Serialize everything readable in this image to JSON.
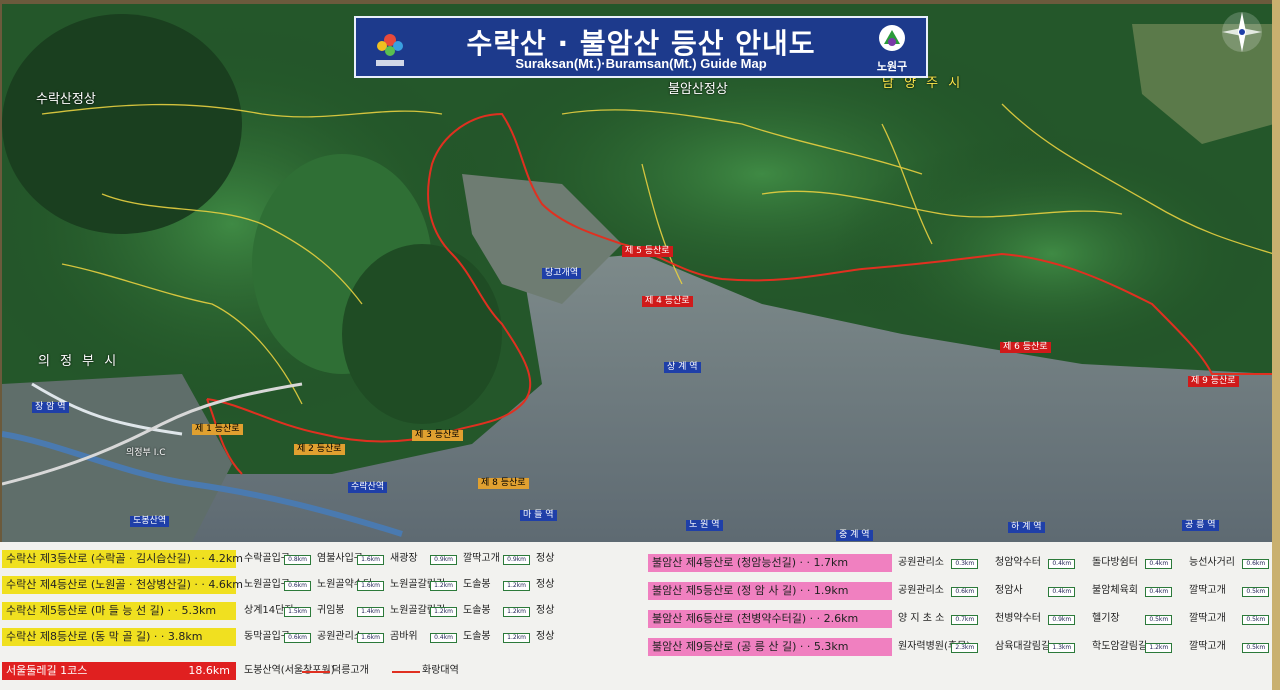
{
  "title": {
    "main": "수락산 · 불암산 등산 안내도",
    "sub": "Suraksan(Mt.)·Buramsan(Mt.) Guide Map",
    "org": "노원구"
  },
  "map_labels": {
    "cities": [
      {
        "name": "의 정 부 시",
        "color": "white"
      },
      {
        "name": "남 양 주 시",
        "color": "yellow"
      }
    ],
    "peaks": [
      {
        "name": "수락산정상"
      },
      {
        "name": "불암산정상"
      }
    ],
    "stations": [
      {
        "name": "장 암 역"
      },
      {
        "name": "도봉산역"
      },
      {
        "name": "수락산역"
      },
      {
        "name": "마 들 역"
      },
      {
        "name": "당고개역"
      },
      {
        "name": "상 계 역"
      },
      {
        "name": "노 원 역"
      },
      {
        "name": "중 계 역"
      },
      {
        "name": "하 계 역"
      },
      {
        "name": "공 릉 역"
      }
    ],
    "places": [
      {
        "name": "의정부 I.C"
      },
      {
        "name": "제 1 등산로"
      },
      {
        "name": "제 2 등산로"
      },
      {
        "name": "제 3 등산로"
      },
      {
        "name": "제 4 등산로"
      },
      {
        "name": "제 5 등산로"
      },
      {
        "name": "제 6 등산로"
      },
      {
        "name": "제 8 등산로"
      },
      {
        "name": "제 9 등산로"
      }
    ]
  },
  "legend": {
    "left_routes": [
      {
        "label": "수락산 제3등산로 (수락골 · 김시습산길) · · 4.2km",
        "color": "yellow",
        "stops": [
          "수락골입구",
          "염불사입구",
          "새광장",
          "깔딱고개",
          "정상"
        ],
        "dists": [
          "0.8km",
          "1.6km",
          "0.9km",
          "0.9km"
        ]
      },
      {
        "label": "수락산 제4등산로 (노원골 · 천상병산길) · · 4.6km",
        "color": "yellow",
        "stops": [
          "노원골입구",
          "노원골약수터",
          "노원골갈림길",
          "도솔봉",
          "정상"
        ],
        "dists": [
          "0.6km",
          "1.6km",
          "1.2km",
          "1.2km"
        ]
      },
      {
        "label": "수락산 제5등산로 (마 들 능 선 길) · · 5.3km",
        "color": "yellow",
        "stops": [
          "상계14단지",
          "귀임봉",
          "노원골갈림길",
          "도솔봉",
          "정상"
        ],
        "dists": [
          "1.5km",
          "1.4km",
          "1.2km",
          "1.2km"
        ]
      },
      {
        "label": "수락산 제8등산로 (동   막   골   길) · · 3.8km",
        "color": "yellow",
        "stops": [
          "동막골입구",
          "공원관리소",
          "곰바위",
          "도솔봉",
          "정상"
        ],
        "dists": [
          "0.6km",
          "1.6km",
          "0.4km",
          "1.2km"
        ]
      }
    ],
    "right_routes": [
      {
        "label": "불암산 제4등산로 (청암능선길) · · 1.7km",
        "color": "pink",
        "stops": [
          "공원관리소",
          "청암약수터",
          "돌다방쉼터",
          "능선사거리"
        ],
        "dists": [
          "0.3km",
          "0.4km",
          "0.4km",
          "0.6km"
        ]
      },
      {
        "label": "불암산 제5등산로 (정 암 사 길) · · 1.9km",
        "color": "pink",
        "stops": [
          "공원관리소",
          "정암사",
          "불암체육회",
          "깔딱고개"
        ],
        "dists": [
          "0.6km",
          "0.4km",
          "0.4km",
          "0.5km"
        ]
      },
      {
        "label": "불암산 제6등산로 (천병약수터길) · · 2.6km",
        "color": "pink",
        "stops": [
          "양 지 초 소",
          "천병약수터",
          "헬기장",
          "깔딱고개"
        ],
        "dists": [
          "0.7km",
          "0.9km",
          "0.5km",
          "0.5km"
        ]
      },
      {
        "label": "불암산 제9등산로 (공 릉 산 길) · · 5.3km",
        "color": "pink",
        "stops": [
          "원자력병원(후문)",
          "삼육대갈림길",
          "학도암갈림길",
          "깔딱고개"
        ],
        "dists": [
          "2.3km",
          "1.3km",
          "1.2km",
          "0.5km"
        ]
      }
    ],
    "dulle": {
      "label": "서울둘레길 1코스",
      "distance": "18.6km",
      "stops": [
        "도봉산역(서울창포원)",
        "덕릉고개",
        "화랑대역"
      ]
    }
  }
}
